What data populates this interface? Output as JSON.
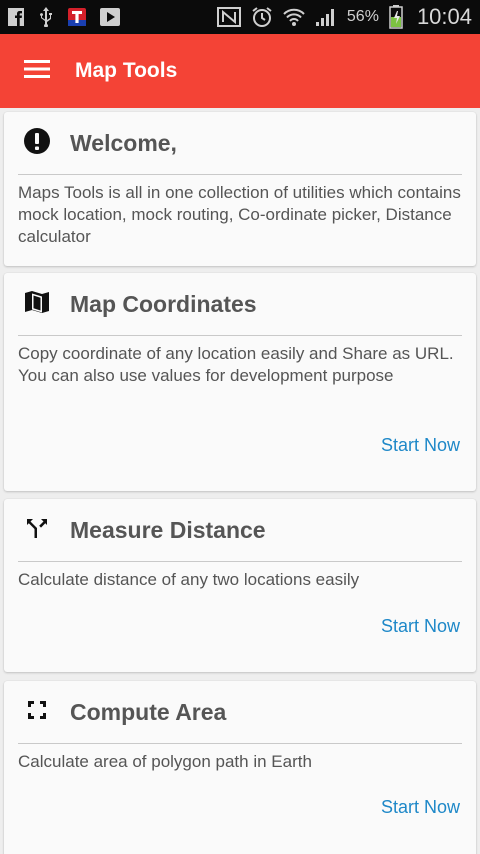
{
  "status_bar": {
    "left_icons": [
      "facebook-icon",
      "usb-icon",
      "app-notification-icon",
      "media-player-icon"
    ],
    "right_icons": [
      "nfc-icon",
      "alarm-icon",
      "wifi-icon",
      "signal-icon",
      "battery-icon"
    ],
    "battery": "56%",
    "time": "10:04"
  },
  "app_bar": {
    "title": "Map Tools",
    "color": "#f44336",
    "menu_icon": "hamburger-menu-icon"
  },
  "cards": [
    {
      "icon": "alert-circle-icon",
      "title": "Welcome,",
      "description": "Maps Tools is all in one collection of utilities which contains mock location, mock routing, Co-ordinate picker, Distance calculator"
    },
    {
      "icon": "map-icon",
      "title": "Map Coordinates",
      "description": "Copy coordinate of any location easily and Share as URL. You can also use values for development purpose",
      "action": "Start Now"
    },
    {
      "icon": "call-split-icon",
      "title": "Measure Distance",
      "description": "Calculate distance of any two locations easily",
      "action": "Start Now"
    },
    {
      "icon": "fullscreen-icon",
      "title": "Compute Area",
      "description": "Calculate area of polygon path in Earth",
      "action": "Start Now"
    }
  ],
  "colors": {
    "accent": "#f44336",
    "link": "#1e88c8",
    "text": "#555555"
  }
}
